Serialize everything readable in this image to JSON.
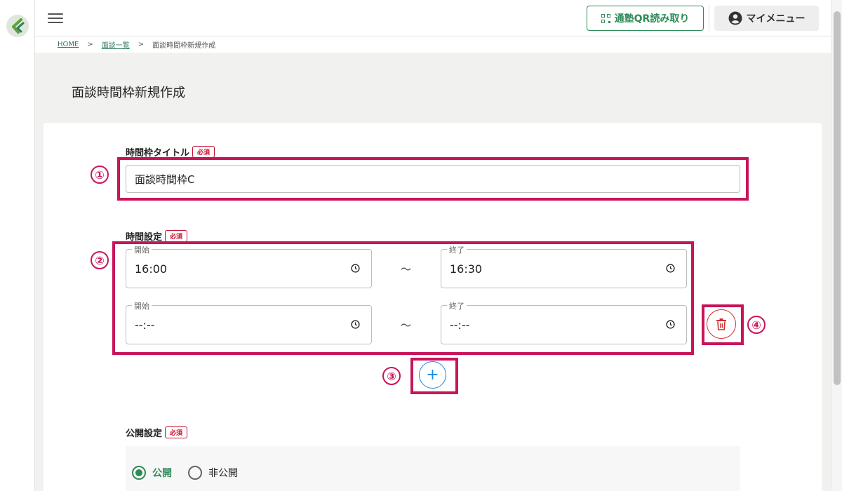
{
  "header": {
    "qr_button": "通塾QR読み取り",
    "menu_button": "マイメニュー"
  },
  "breadcrumb": {
    "home": "HOME",
    "separator": ">",
    "list": "面談一覧",
    "current": "面談時間枠新規作成"
  },
  "page": {
    "title": "面談時間枠新規作成"
  },
  "form": {
    "title_label": "時間枠タイトル",
    "required_badge": "必須",
    "title_value": "面談時間枠C",
    "time_label": "時間設定",
    "start_legend": "開始",
    "end_legend": "終了",
    "tilde": "～",
    "slots": [
      {
        "start": "16:00",
        "end": "16:30"
      },
      {
        "start": "--:--",
        "end": "--:--"
      }
    ],
    "add_symbol": "+",
    "visibility_label": "公開設定",
    "visibility_options": [
      "公開",
      "非公開"
    ],
    "visibility_selected": "公開"
  },
  "annotations": [
    "①",
    "②",
    "③",
    "④"
  ],
  "colors": {
    "accent_green": "#2e8b57",
    "highlight": "#c8155a",
    "required": "#c8102e",
    "delete": "#d32f2f",
    "add": "#1e88e5"
  }
}
